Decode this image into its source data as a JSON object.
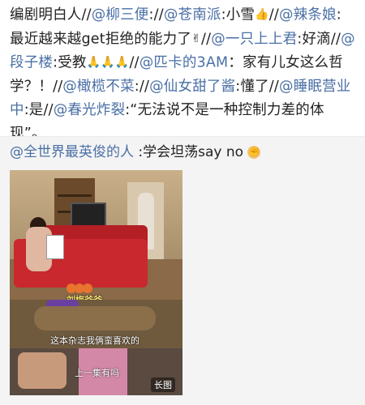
{
  "post": {
    "p01": "编剧明白人//",
    "u01": "@柳三便",
    "p02": "://",
    "u02": "@苍南派",
    "p03": ":小雪",
    "e01": "👍",
    "p04": "//",
    "u03": "@辣条娘",
    "p05": ":最近越来越get拒绝的能力了",
    "e02": "✌",
    "p06": "//",
    "u04": "@一只上上君",
    "p07": ":好滴//",
    "u05": "@段子楼",
    "p08": ":受教",
    "e03": "🙏🙏🙏",
    "p09": "//",
    "u06": "@匹卡的3AM",
    "p10": "：家有儿女这么哲学？！//",
    "u07": "@橄榄不菜",
    "p11": "://",
    "u08": "@仙女甜了酱",
    "p12": ":懂了//",
    "u09": "@睡眠营业中",
    "p13": ":是//",
    "u10": "@春光炸裂",
    "p14": ":“无法说不是一种控制力差的体现”。"
  },
  "comment": {
    "user": "@全世界最英俊的人",
    "text": " :学会坦荡say no",
    "emoji": "✊"
  },
  "photo": {
    "caption1": "刘梅爸爸",
    "caption2": "这本杂志我俩蛮喜欢的",
    "caption3": "上一集有吗",
    "tag": "长图"
  },
  "colors": {
    "link": "#4a6fa5",
    "text": "#222222",
    "comment_bg": "#f4f4f4"
  }
}
